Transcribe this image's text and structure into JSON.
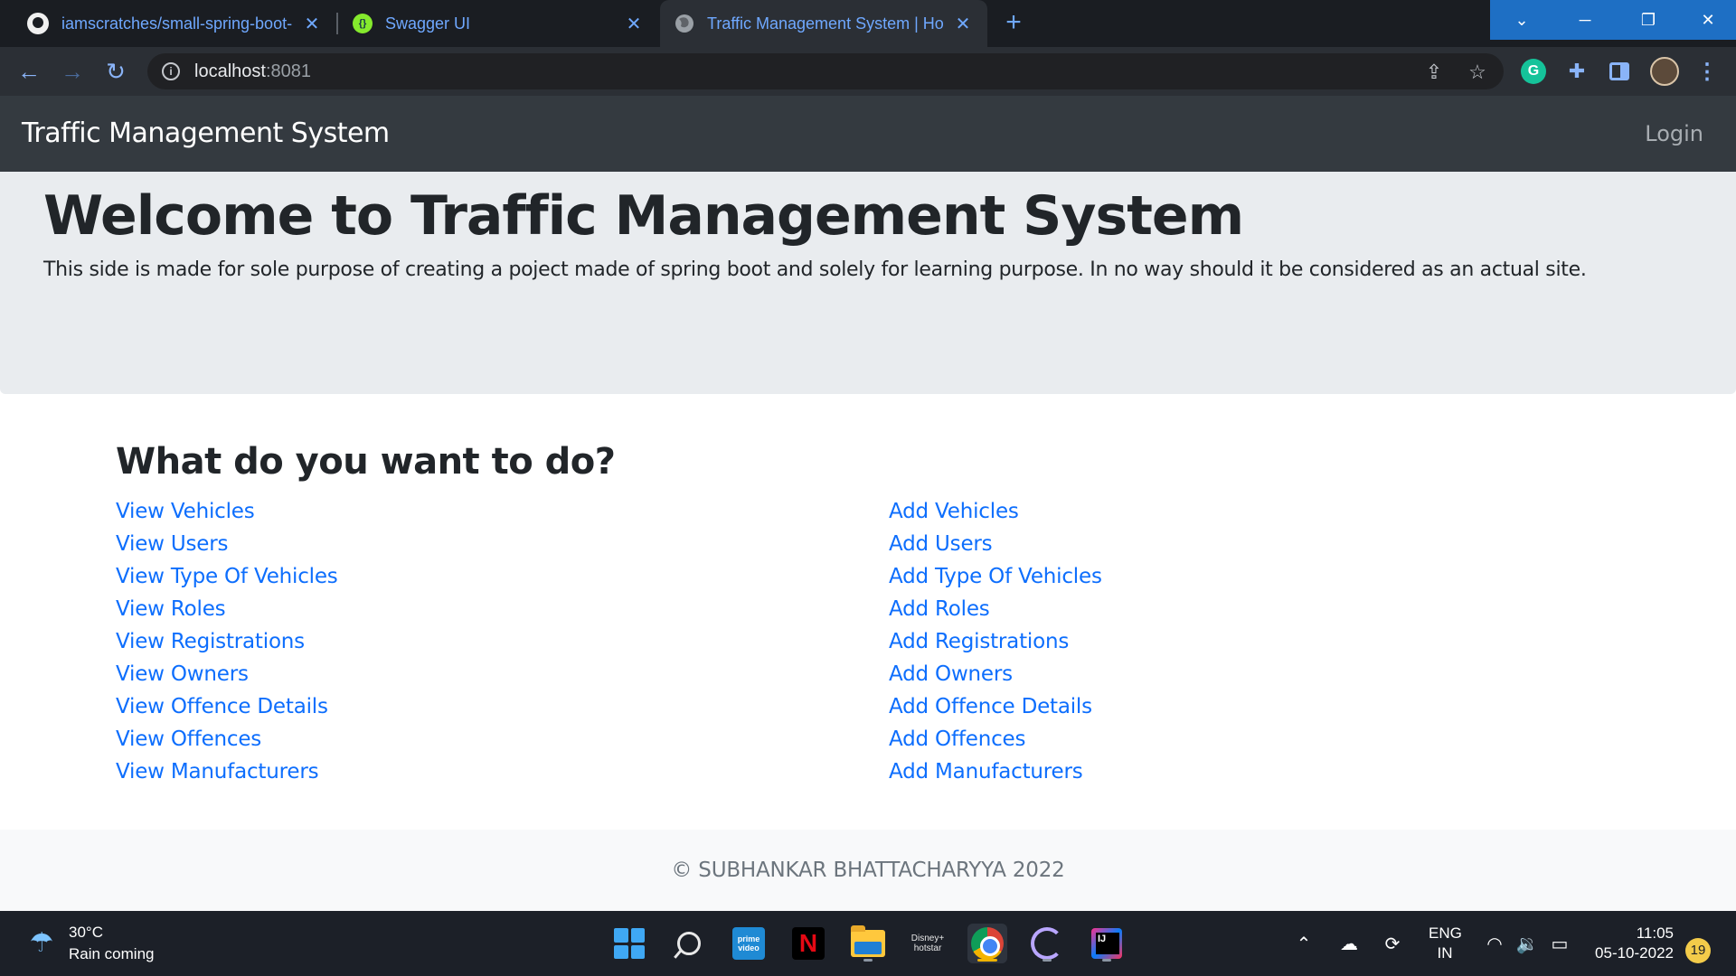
{
  "browser": {
    "tabs": [
      {
        "title": "iamscratches/small-spring-boot-",
        "favicon": "github-icon",
        "active": false
      },
      {
        "title": "Swagger UI",
        "favicon": "swagger-icon",
        "active": false
      },
      {
        "title": "Traffic Management System | Ho",
        "favicon": "globe-icon",
        "active": true
      }
    ],
    "new_tab": "+",
    "url": {
      "host": "localhost",
      "port": ":8081"
    }
  },
  "navbar": {
    "brand": "Traffic Management System",
    "login": "Login"
  },
  "jumbotron": {
    "title": "Welcome to Traffic Management System",
    "text": "This side is made for sole purpose of creating a poject made of spring boot and solely for learning purpose. In no way should it be considered as an actual site."
  },
  "actions": {
    "heading": "What do you want to do?",
    "view_links": [
      "View Vehicles",
      "View Users",
      "View Type Of Vehicles",
      "View Roles",
      "View Registrations",
      "View Owners",
      "View Offence Details",
      "View Offences",
      "View Manufacturers"
    ],
    "add_links": [
      "Add Vehicles",
      "Add Users",
      "Add Type Of Vehicles",
      "Add Roles",
      "Add Registrations",
      "Add Owners",
      "Add Offence Details",
      "Add Offences",
      "Add Manufacturers"
    ]
  },
  "footer": {
    "text": "© SUBHANKAR BHATTACHARYYA 2022"
  },
  "taskbar": {
    "weather": {
      "temp": "30°C",
      "status": "Rain coming"
    },
    "language": {
      "line1": "ENG",
      "line2": "IN"
    },
    "clock": {
      "time": "11:05",
      "date": "05-10-2022"
    },
    "notifications": "19"
  },
  "colors": {
    "navbar": "#343a40",
    "jumbotron": "#e9ecef",
    "link": "#0d6efd",
    "footer": "#f8f9fa"
  }
}
